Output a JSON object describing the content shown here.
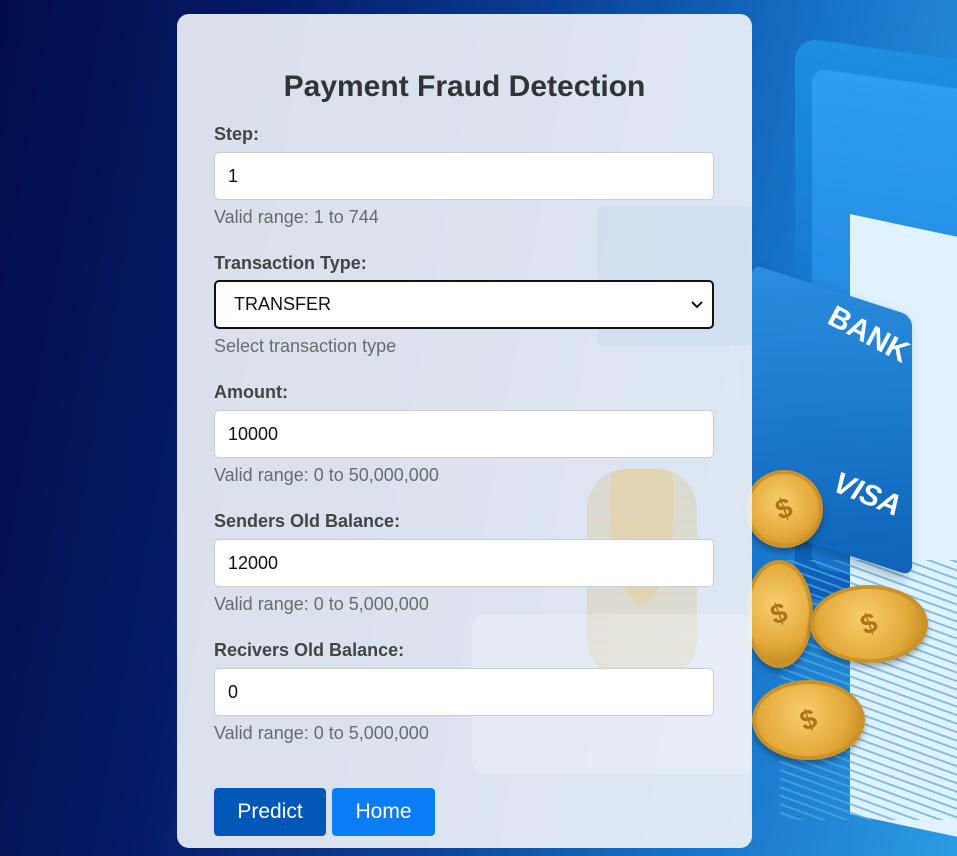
{
  "form": {
    "title": "Payment Fraud Detection",
    "step": {
      "label": "Step:",
      "value": "1",
      "hint": "Valid range: 1 to 744"
    },
    "transaction_type": {
      "label": "Transaction Type:",
      "selected": "TRANSFER",
      "hint": "Select transaction type"
    },
    "amount": {
      "label": "Amount:",
      "value": "10000",
      "hint": "Valid range: 0 to 50,000,000"
    },
    "senders_old_balance": {
      "label": "Senders Old Balance:",
      "value": "12000",
      "hint": "Valid range: 0 to 5,000,000"
    },
    "recivers_old_balance": {
      "label": "Recivers Old Balance:",
      "value": "0",
      "hint": "Valid range: 0 to 5,000,000"
    }
  },
  "buttons": {
    "predict_label": "Predict",
    "home_label": "Home"
  },
  "background": {
    "bank_text": "BANK",
    "visa_text": "VISA"
  },
  "colors": {
    "predict_button": "#0057b8",
    "home_button": "#0a7cf5",
    "background_dark": "#020c4a",
    "background_light": "#2c9ae4"
  },
  "icons": {
    "select_arrow": "chevron-down-icon",
    "coin": "dollar-coin-icon"
  }
}
